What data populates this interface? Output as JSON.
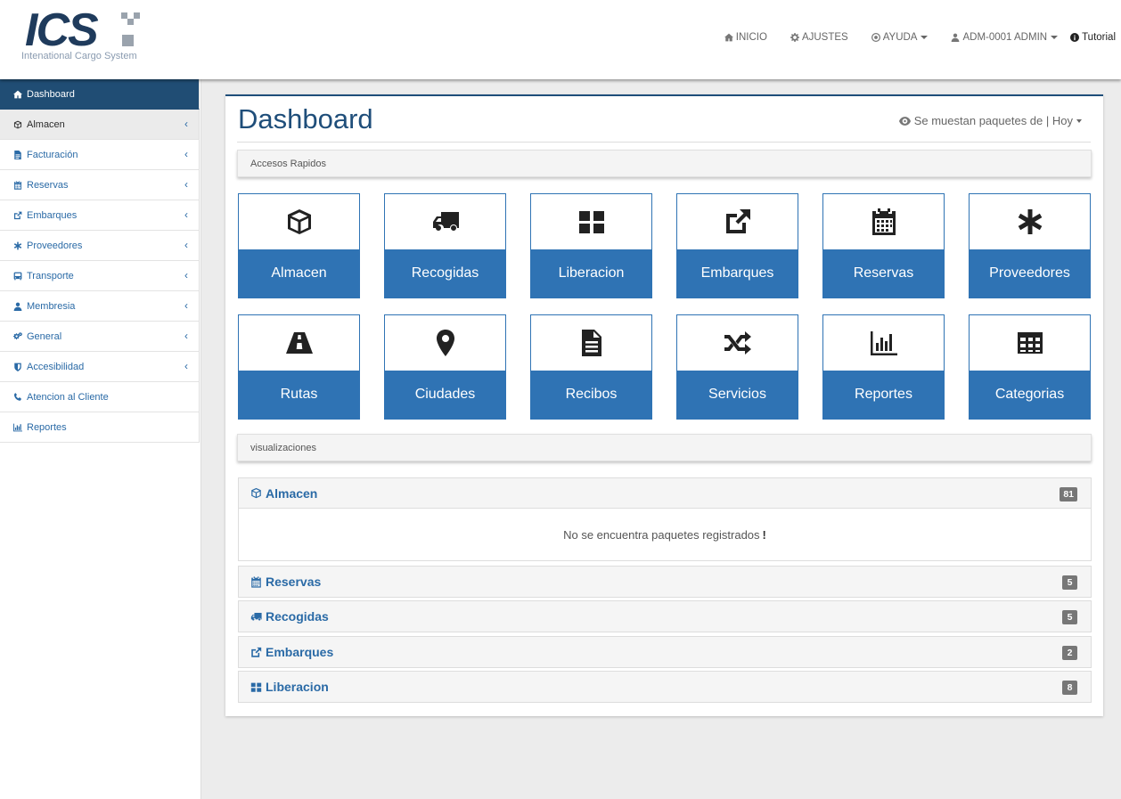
{
  "header": {
    "logo_text": "ICS",
    "logo_subtitle": "Intenational Cargo System",
    "nav": [
      {
        "label": "INICIO",
        "icon": "home-icon"
      },
      {
        "label": "AJUSTES",
        "icon": "gear-icon"
      },
      {
        "label": "AYUDA",
        "icon": "lifebuoy-icon"
      },
      {
        "label": "ADM-0001 ADMIN",
        "icon": "user-icon"
      },
      {
        "label": "Tutorial",
        "icon": "info-icon"
      }
    ]
  },
  "sidebar": {
    "items": [
      {
        "label": "Dashboard",
        "icon": "home-icon"
      },
      {
        "label": "Almacen",
        "icon": "cube-icon"
      },
      {
        "label": "Facturación",
        "icon": "file-icon"
      },
      {
        "label": "Reservas",
        "icon": "calendar-icon"
      },
      {
        "label": "Embarques",
        "icon": "external-link-icon"
      },
      {
        "label": "Proveedores",
        "icon": "asterisk-icon"
      },
      {
        "label": "Transporte",
        "icon": "bus-icon"
      },
      {
        "label": "Membresia",
        "icon": "user-icon"
      },
      {
        "label": "General",
        "icon": "gears-icon"
      },
      {
        "label": "Accesibilidad",
        "icon": "shield-icon"
      },
      {
        "label": "Atencion al Cliente",
        "icon": "phone-icon"
      },
      {
        "label": "Reportes",
        "icon": "bar-chart-icon"
      }
    ],
    "chevron": "‹"
  },
  "main": {
    "title": "Dashboard",
    "filter_label": "Se muestan paquetes de | Hoy",
    "quick_access_label": "Accesos Rapidos",
    "tiles": [
      {
        "label": "Almacen",
        "icon": "cube-icon"
      },
      {
        "label": "Recogidas",
        "icon": "truck-icon"
      },
      {
        "label": "Liberacion",
        "icon": "th-large-icon"
      },
      {
        "label": "Embarques",
        "icon": "external-link-icon"
      },
      {
        "label": "Reservas",
        "icon": "calendar-icon"
      },
      {
        "label": "Proveedores",
        "icon": "asterisk-icon"
      },
      {
        "label": "Rutas",
        "icon": "road-icon"
      },
      {
        "label": "Ciudades",
        "icon": "map-marker-icon"
      },
      {
        "label": "Recibos",
        "icon": "file-text-icon"
      },
      {
        "label": "Servicios",
        "icon": "random-icon"
      },
      {
        "label": "Reportes",
        "icon": "area-chart-icon"
      },
      {
        "label": "Categorias",
        "icon": "table-icon"
      }
    ],
    "visualizations_label": "visualizaciones",
    "panels": [
      {
        "title": "Almacen",
        "icon": "cube-icon",
        "count": "81",
        "empty_message": "No se encuentra paquetes registrados",
        "empty_mark": "!"
      },
      {
        "title": "Reservas",
        "icon": "calendar-icon",
        "count": "5"
      },
      {
        "title": "Recogidas",
        "icon": "truck-icon",
        "count": "5"
      },
      {
        "title": "Embarques",
        "icon": "external-link-icon",
        "count": "2"
      },
      {
        "title": "Liberacion",
        "icon": "th-large-icon",
        "count": "8"
      }
    ]
  },
  "colors": {
    "brand_dark": "#204d74",
    "tile_blue": "#2f73b4",
    "link_blue": "#2a6aa6",
    "badge_gray": "#777777"
  }
}
